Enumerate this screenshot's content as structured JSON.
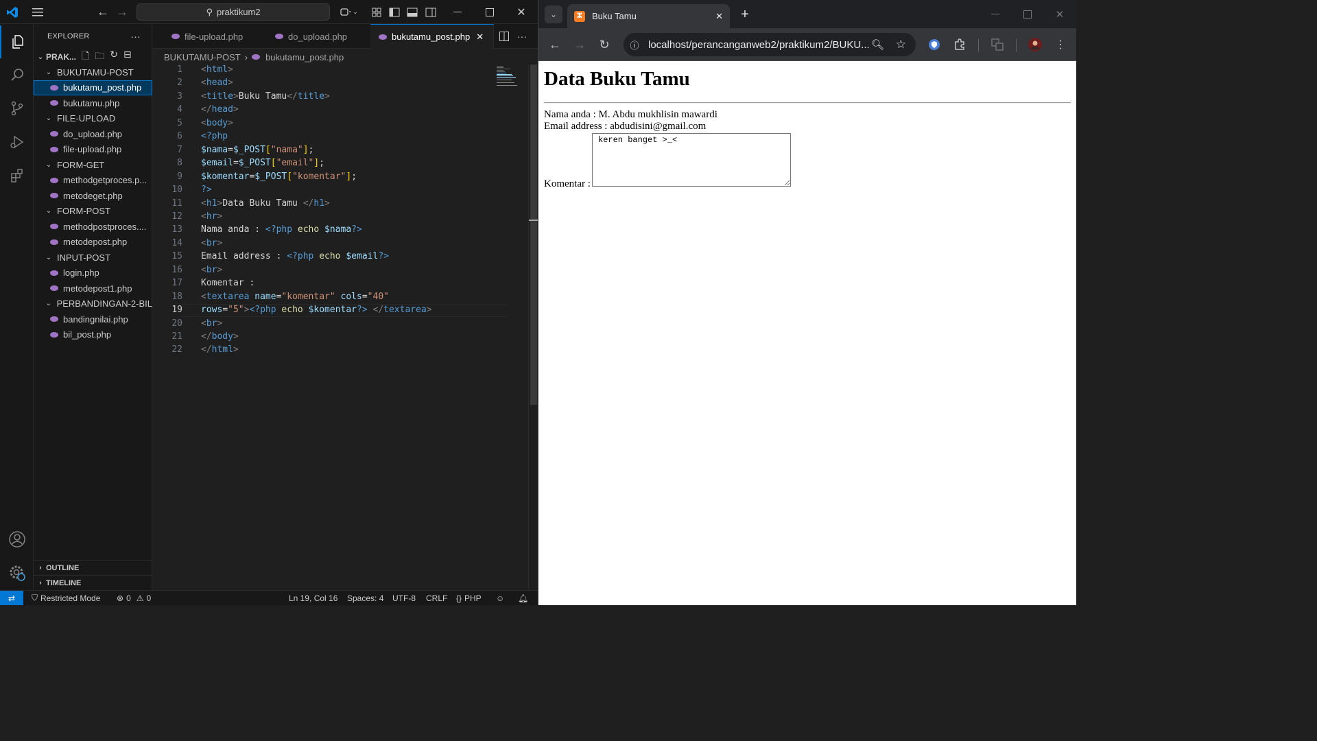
{
  "vscode": {
    "search_text": "praktikum2",
    "explorer_title": "EXPLORER",
    "workspace": "PRAK...",
    "tree": [
      {
        "type": "folder",
        "label": "BUKUTAMU-POST"
      },
      {
        "type": "file",
        "label": "bukutamu_post.php",
        "selected": true
      },
      {
        "type": "file",
        "label": "bukutamu.php"
      },
      {
        "type": "folder",
        "label": "FILE-UPLOAD"
      },
      {
        "type": "file",
        "label": "do_upload.php"
      },
      {
        "type": "file",
        "label": "file-upload.php"
      },
      {
        "type": "folder",
        "label": "FORM-GET"
      },
      {
        "type": "file",
        "label": "methodgetproces.p..."
      },
      {
        "type": "file",
        "label": "metodeget.php"
      },
      {
        "type": "folder",
        "label": "FORM-POST"
      },
      {
        "type": "file",
        "label": "methodpostproces...."
      },
      {
        "type": "file",
        "label": "metodepost.php"
      },
      {
        "type": "folder",
        "label": "INPUT-POST"
      },
      {
        "type": "file",
        "label": "login.php"
      },
      {
        "type": "file",
        "label": "metodepost1.php"
      },
      {
        "type": "folder",
        "label": "PERBANDINGAN-2-BIL"
      },
      {
        "type": "file",
        "label": "bandingnilai.php"
      },
      {
        "type": "file",
        "label": "bil_post.php"
      }
    ],
    "outline_label": "OUTLINE",
    "timeline_label": "TIMELINE",
    "tabs": [
      {
        "label": "file-upload.php"
      },
      {
        "label": "do_upload.php"
      },
      {
        "label": "bukutamu_post.php",
        "active": true
      }
    ],
    "breadcrumb": {
      "folder": "BUKUTAMU-POST",
      "file": "bukutamu_post.php"
    },
    "current_line": 19,
    "code_lines": [
      [
        [
          "t",
          "<"
        ],
        [
          "tn",
          "html"
        ],
        [
          "t",
          ">"
        ]
      ],
      [
        [
          "t",
          "<"
        ],
        [
          "tn",
          "head"
        ],
        [
          "t",
          ">"
        ]
      ],
      [
        [
          "t",
          "<"
        ],
        [
          "tn",
          "title"
        ],
        [
          "t",
          ">"
        ],
        [
          "o",
          "Buku Tamu"
        ],
        [
          "t",
          "</"
        ],
        [
          "tn",
          "title"
        ],
        [
          "t",
          ">"
        ]
      ],
      [
        [
          "t",
          "</"
        ],
        [
          "tn",
          "head"
        ],
        [
          "t",
          ">"
        ]
      ],
      [
        [
          "t",
          "<"
        ],
        [
          "tn",
          "body"
        ],
        [
          "t",
          ">"
        ]
      ],
      [
        [
          "p",
          "<?php"
        ]
      ],
      [
        [
          "v",
          "$nama"
        ],
        [
          "o",
          "="
        ],
        [
          "v",
          "$_POST"
        ],
        [
          "y",
          "["
        ],
        [
          "s",
          "\"nama\""
        ],
        [
          "y",
          "]"
        ],
        [
          "o",
          ";"
        ]
      ],
      [
        [
          "v",
          "$email"
        ],
        [
          "o",
          "="
        ],
        [
          "v",
          "$_POST"
        ],
        [
          "y",
          "["
        ],
        [
          "s",
          "\"email\""
        ],
        [
          "y",
          "]"
        ],
        [
          "o",
          ";"
        ]
      ],
      [
        [
          "v",
          "$komentar"
        ],
        [
          "o",
          "="
        ],
        [
          "v",
          "$_POST"
        ],
        [
          "y",
          "["
        ],
        [
          "s",
          "\"komentar\""
        ],
        [
          "y",
          "]"
        ],
        [
          "o",
          ";"
        ]
      ],
      [
        [
          "p",
          "?>"
        ]
      ],
      [
        [
          "t",
          "<"
        ],
        [
          "tn",
          "h1"
        ],
        [
          "t",
          ">"
        ],
        [
          "o",
          "Data Buku Tamu "
        ],
        [
          "t",
          "</"
        ],
        [
          "tn",
          "h1"
        ],
        [
          "t",
          ">"
        ]
      ],
      [
        [
          "t",
          "<"
        ],
        [
          "tn",
          "hr"
        ],
        [
          "t",
          ">"
        ]
      ],
      [
        [
          "o",
          "Nama anda : "
        ],
        [
          "p",
          "<?php"
        ],
        [
          "o",
          " "
        ],
        [
          "f",
          "echo"
        ],
        [
          "o",
          " "
        ],
        [
          "v",
          "$nama"
        ],
        [
          "p",
          "?>"
        ]
      ],
      [
        [
          "t",
          "<"
        ],
        [
          "tn",
          "br"
        ],
        [
          "t",
          ">"
        ]
      ],
      [
        [
          "o",
          "Email address : "
        ],
        [
          "p",
          "<?php"
        ],
        [
          "o",
          " "
        ],
        [
          "f",
          "echo"
        ],
        [
          "o",
          " "
        ],
        [
          "v",
          "$email"
        ],
        [
          "p",
          "?>"
        ]
      ],
      [
        [
          "t",
          "<"
        ],
        [
          "tn",
          "br"
        ],
        [
          "t",
          ">"
        ]
      ],
      [
        [
          "o",
          "Komentar :"
        ]
      ],
      [
        [
          "t",
          "<"
        ],
        [
          "tn",
          "textarea"
        ],
        [
          "o",
          " "
        ],
        [
          "a",
          "name"
        ],
        [
          "o",
          "="
        ],
        [
          "s",
          "\"komentar\""
        ],
        [
          "o",
          " "
        ],
        [
          "a",
          "cols"
        ],
        [
          "o",
          "="
        ],
        [
          "s",
          "\"40\""
        ]
      ],
      [
        [
          "a",
          "rows"
        ],
        [
          "o",
          "="
        ],
        [
          "s",
          "\"5\""
        ],
        [
          "t",
          ">"
        ],
        [
          "p",
          "<?php"
        ],
        [
          "o",
          " "
        ],
        [
          "f",
          "echo"
        ],
        [
          "o",
          " "
        ],
        [
          "v",
          "$komentar"
        ],
        [
          "p",
          "?>"
        ],
        [
          "o",
          " "
        ],
        [
          "t",
          "</"
        ],
        [
          "tn",
          "textarea"
        ],
        [
          "t",
          ">"
        ]
      ],
      [
        [
          "t",
          "<"
        ],
        [
          "tn",
          "br"
        ],
        [
          "t",
          ">"
        ]
      ],
      [
        [
          "t",
          "</"
        ],
        [
          "tn",
          "body"
        ],
        [
          "t",
          ">"
        ]
      ],
      [
        [
          "t",
          "</"
        ],
        [
          "tn",
          "html"
        ],
        [
          "t",
          ">"
        ]
      ]
    ],
    "status": {
      "restricted": "Restricted Mode",
      "errors": "0",
      "warnings": "0",
      "position": "Ln 19, Col 16",
      "spaces": "Spaces: 4",
      "encoding": "UTF-8",
      "eol": "CRLF",
      "language": "PHP"
    }
  },
  "browser": {
    "tab_title": "Buku Tamu",
    "url": "localhost/perancanganweb2/praktikum2/BUKU...",
    "page": {
      "heading": "Data Buku Tamu",
      "line1": "Nama anda : M. Abdu mukhlisin mawardi",
      "line2": "Email address : abdudisini@gmail.com",
      "komentar_label": "Komentar :",
      "komentar_value": "keren banget >_<"
    }
  }
}
